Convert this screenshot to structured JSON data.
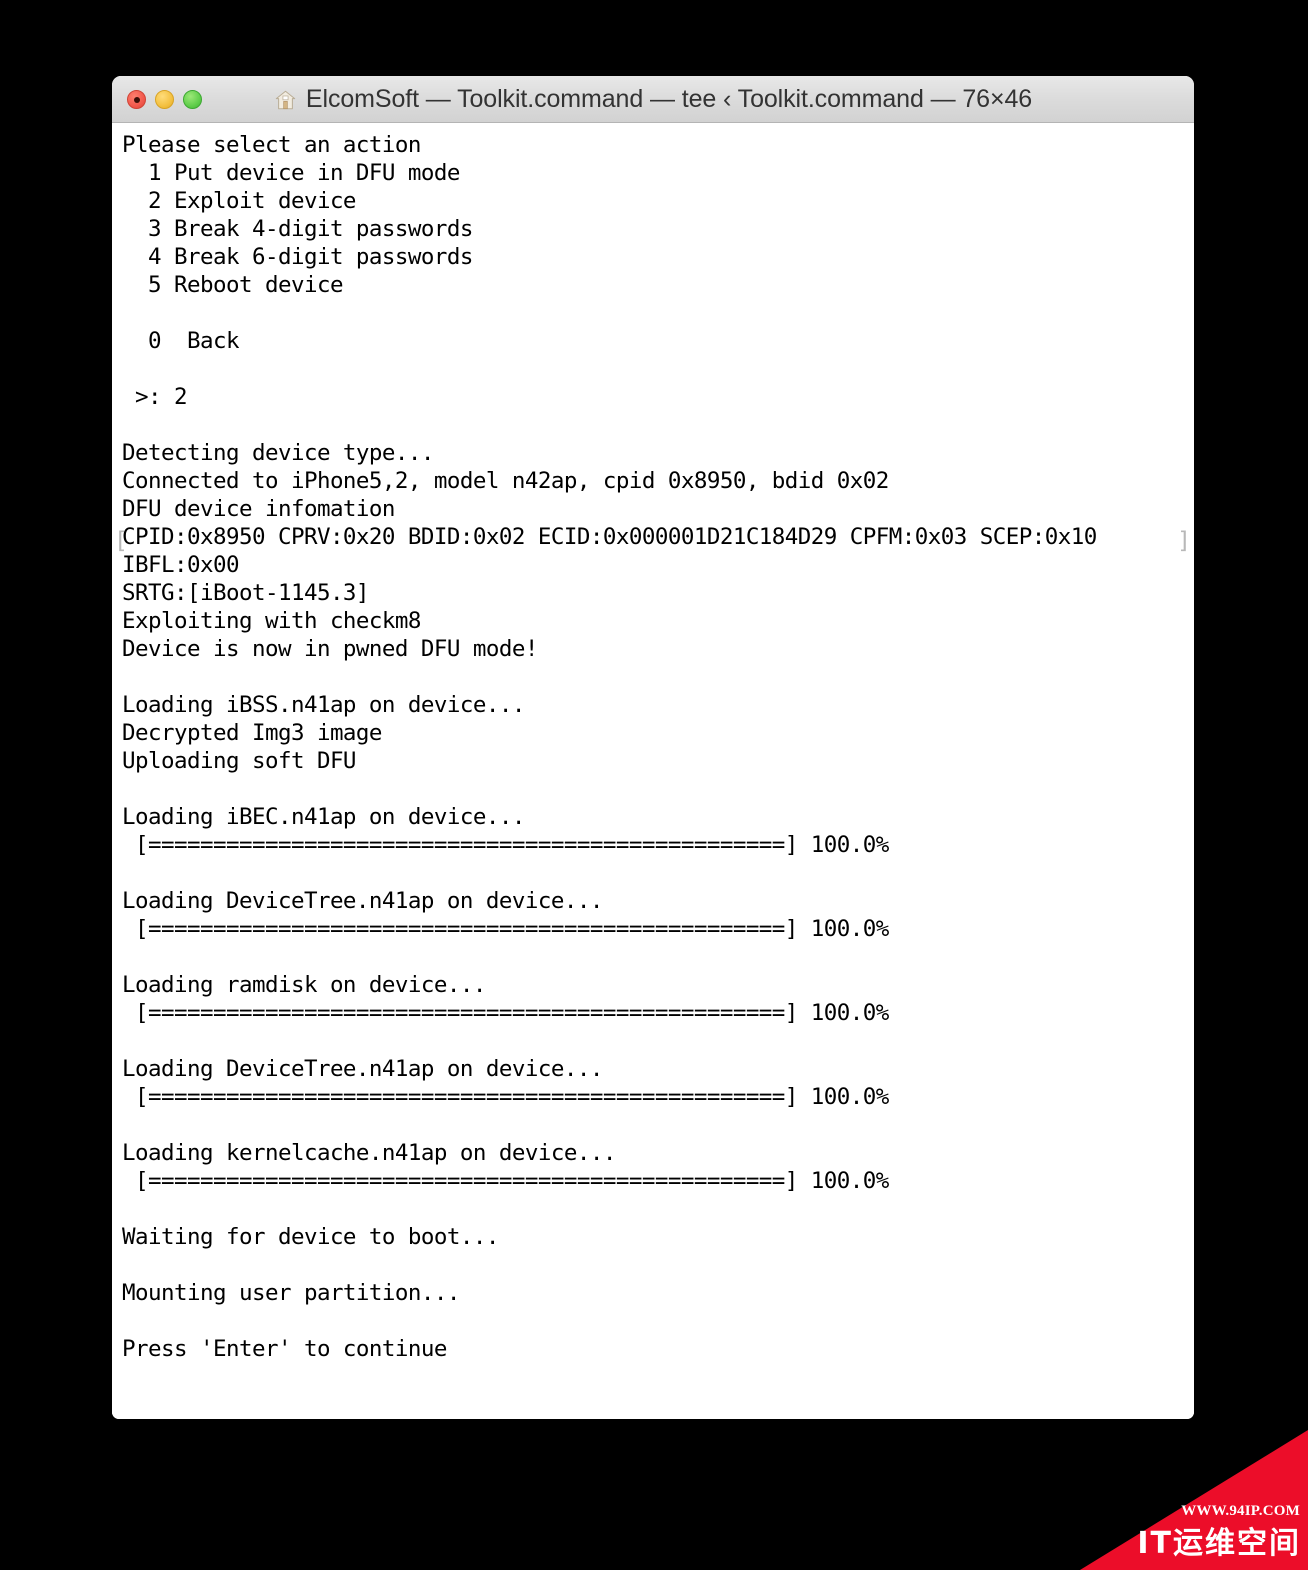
{
  "window": {
    "title": "ElcomSoft — Toolkit.command — tee ‹ Toolkit.command — 76×46",
    "columns": 76,
    "rows": 46,
    "traffic_lights": {
      "close_label": "close",
      "minimize_label": "minimize",
      "zoom_label": "zoom"
    },
    "proxy_icon": "home-icon"
  },
  "terminal": {
    "foreground_color": "#000000",
    "background_color": "#ffffff",
    "cursor_color": "#9a9a9a",
    "mark_color": "#b8b8b8",
    "prompt_mark_left": "[",
    "prompt_mark_right": "]",
    "menu": {
      "heading": "Please select an action",
      "options": [
        "  1 Put device in DFU mode",
        "  2 Exploit device",
        "  3 Break 4-digit passwords",
        "  4 Break 6-digit passwords",
        "  5 Reboot device"
      ],
      "back_option": "  0  Back",
      "prompt": " >: ",
      "entered_value": "2"
    },
    "progress_bar": {
      "fill_char": "=",
      "open_bracket": "[",
      "close_bracket": "]",
      "percent_label": "100.0%",
      "fill_count": 49
    },
    "lines": [
      "Please select an action",
      "  1 Put device in DFU mode",
      "  2 Exploit device",
      "  3 Break 4-digit passwords",
      "  4 Break 6-digit passwords",
      "  5 Reboot device",
      "",
      "  0  Back",
      "",
      " >: 2",
      "",
      "Detecting device type...",
      "Connected to iPhone5,2, model n42ap, cpid 0x8950, bdid 0x02",
      "DFU device infomation",
      "CPID:0x8950 CPRV:0x20 BDID:0x02 ECID:0x000001D21C184D29 CPFM:0x03 SCEP:0x10",
      "IBFL:0x00",
      "SRTG:[iBoot-1145.3]",
      "Exploiting with checkm8",
      "Device is now in pwned DFU mode!",
      "",
      "Loading iBSS.n41ap on device...",
      "Decrypted Img3 image",
      "Uploading soft DFU",
      "",
      "Loading iBEC.n41ap on device...",
      " [=================================================] 100.0%",
      "",
      "Loading DeviceTree.n41ap on device...",
      " [=================================================] 100.0%",
      "",
      "Loading ramdisk on device...",
      " [=================================================] 100.0%",
      "",
      "Loading DeviceTree.n41ap on device...",
      " [=================================================] 100.0%",
      "",
      "Loading kernelcache.n41ap on device...",
      " [=================================================] 100.0%",
      "",
      "Waiting for device to boot...",
      "",
      "Mounting user partition...",
      "",
      "Press 'Enter' to continue"
    ]
  },
  "watermark": {
    "url": "WWW.94IP.COM",
    "brand": "IT运维空间",
    "accent_color": "#ec0d29"
  }
}
